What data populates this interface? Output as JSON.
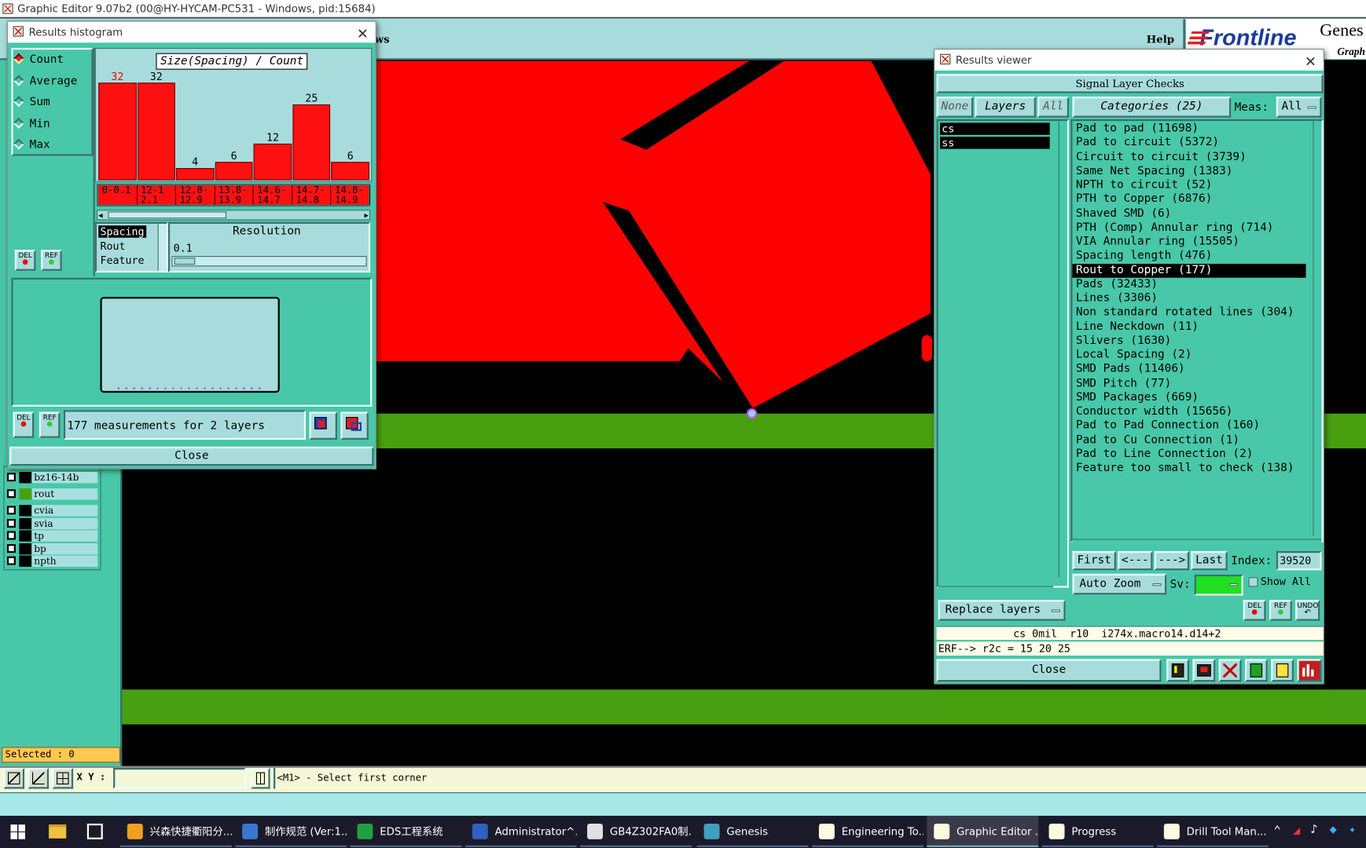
{
  "window": {
    "title": "Graphic Editor 9.07b2 (00@HY-HYCAM-PC531 - Windows, pid:15684)"
  },
  "menu": {
    "help": "Help",
    "partial": "ws"
  },
  "brand": {
    "name": "Frontline",
    "genes": "Genes",
    "graph": "Graph"
  },
  "layers": [
    {
      "name": "bz16-14b",
      "color": "#000000"
    },
    {
      "name": "rout",
      "color": "#48a010"
    },
    {
      "name": "cvia",
      "color": "#000000"
    },
    {
      "name": "svia",
      "color": "#000000"
    },
    {
      "name": "tp",
      "color": "#000000"
    },
    {
      "name": "bp",
      "color": "#000000"
    },
    {
      "name": "npth",
      "color": "#000000"
    }
  ],
  "status": {
    "selected": "Selected : 0",
    "xy_label": "X Y :",
    "xy_value": "",
    "message": "<M1> - Select first corner"
  },
  "histogram": {
    "title": "Results histogram",
    "chart_title": "Size(Spacing) / Count",
    "modes": [
      {
        "label": "Count",
        "selected": true
      },
      {
        "label": "Average",
        "selected": false
      },
      {
        "label": "Sum",
        "selected": false
      },
      {
        "label": "Min",
        "selected": false
      },
      {
        "label": "Max",
        "selected": false
      }
    ],
    "bars": [
      {
        "value": 32,
        "label": "0-0.1",
        "highlight": true
      },
      {
        "value": 32,
        "label": "12-12.1",
        "highlight": false
      },
      {
        "value": 4,
        "label": "12.8-12.9",
        "highlight": false
      },
      {
        "value": 6,
        "label": "13.8-13.9",
        "highlight": false
      },
      {
        "value": 12,
        "label": "14.6-14.7",
        "highlight": false
      },
      {
        "value": 25,
        "label": "14.7-14.8",
        "highlight": false
      },
      {
        "value": 6,
        "label": "14.8-14.9",
        "highlight": false
      }
    ],
    "size_list": [
      "Spacing",
      "Rout",
      "Feature"
    ],
    "resolution_label": "Resolution",
    "resolution_value": "0.1",
    "summary": "177 measurements for 2 layers",
    "close": "Close",
    "del": "DEL",
    "ref": "REF"
  },
  "results_viewer": {
    "title": "Results viewer",
    "header": "Signal Layer Checks",
    "none": "None",
    "layers_btn": "Layers",
    "all_btn": "All",
    "categories_btn": "Categories (25)",
    "meas_label": "Meas:",
    "meas_value": "All",
    "layers": [
      {
        "name": "cs"
      },
      {
        "name": "ss"
      }
    ],
    "categories": [
      {
        "label": "Pad to pad (11698)",
        "selected": false
      },
      {
        "label": "Pad to circuit (5372)",
        "selected": false
      },
      {
        "label": "Circuit to circuit (3739)",
        "selected": false
      },
      {
        "label": "Same Net Spacing (1383)",
        "selected": false
      },
      {
        "label": "NPTH to circuit (52)",
        "selected": false
      },
      {
        "label": "PTH to Copper (6876)",
        "selected": false
      },
      {
        "label": "Shaved SMD (6)",
        "selected": false
      },
      {
        "label": "PTH (Comp) Annular ring (714)",
        "selected": false
      },
      {
        "label": "VIA Annular ring (15505)",
        "selected": false
      },
      {
        "label": "Spacing length (476)",
        "selected": false
      },
      {
        "label": "Rout to Copper (177)",
        "selected": true
      },
      {
        "label": "Pads (32433)",
        "selected": false
      },
      {
        "label": "Lines (3306)",
        "selected": false
      },
      {
        "label": "Non standard rotated lines (304)",
        "selected": false
      },
      {
        "label": "Line Neckdown (11)",
        "selected": false
      },
      {
        "label": "Slivers (1630)",
        "selected": false
      },
      {
        "label": "Local Spacing (2)",
        "selected": false
      },
      {
        "label": "SMD Pads (11406)",
        "selected": false
      },
      {
        "label": "SMD Pitch (77)",
        "selected": false
      },
      {
        "label": "SMD Packages (669)",
        "selected": false
      },
      {
        "label": "Conductor width (15656)",
        "selected": false
      },
      {
        "label": "Pad to Pad Connection (160)",
        "selected": false
      },
      {
        "label": "Pad to Cu Connection (1)",
        "selected": false
      },
      {
        "label": "Pad to Line Connection (2)",
        "selected": false
      },
      {
        "label": "Feature too small to check (138)",
        "selected": false
      }
    ],
    "nav": {
      "first": "First",
      "prev": "<---",
      "next": "--->",
      "last": "Last",
      "index_label": "Index:",
      "index_value": "39520"
    },
    "auto_zoom": "Auto Zoom",
    "sv_label": "Sv:",
    "show_all": "Show All",
    "replace_layers": "Replace layers",
    "undo": "UNDO",
    "info_line": "cs 0mil  r10  i274x.macro14.d14+2",
    "erf_line": "ERF--> r2c = 15 20 25",
    "close": "Close"
  },
  "taskbar": [
    {
      "label": "兴森快捷衢阳分...",
      "color": "#f0a020"
    },
    {
      "label": "制作规范 (Ver:1...",
      "color": "#3a78d0"
    },
    {
      "label": "EDS工程系统",
      "color": "#20a040"
    },
    {
      "label": "Administrator^...",
      "color": "#3060c0"
    },
    {
      "label": "GB4Z302FA0制...",
      "color": "#e0e0e0"
    },
    {
      "label": "Genesis",
      "color": "#40a0c0"
    },
    {
      "label": "Engineering To...",
      "color": "#fffbe0"
    },
    {
      "label": "Graphic Editor ...",
      "color": "#fffbe0"
    },
    {
      "label": "Progress",
      "color": "#fffbe0"
    },
    {
      "label": "Drill Tool Man...",
      "color": "#fffbe0"
    }
  ],
  "colors": {
    "teal": "#48c8a8",
    "light_teal": "#a8dcdc",
    "copper": "#ff0000",
    "rout": "#48a010",
    "histogram_bar": "#ff1010"
  }
}
